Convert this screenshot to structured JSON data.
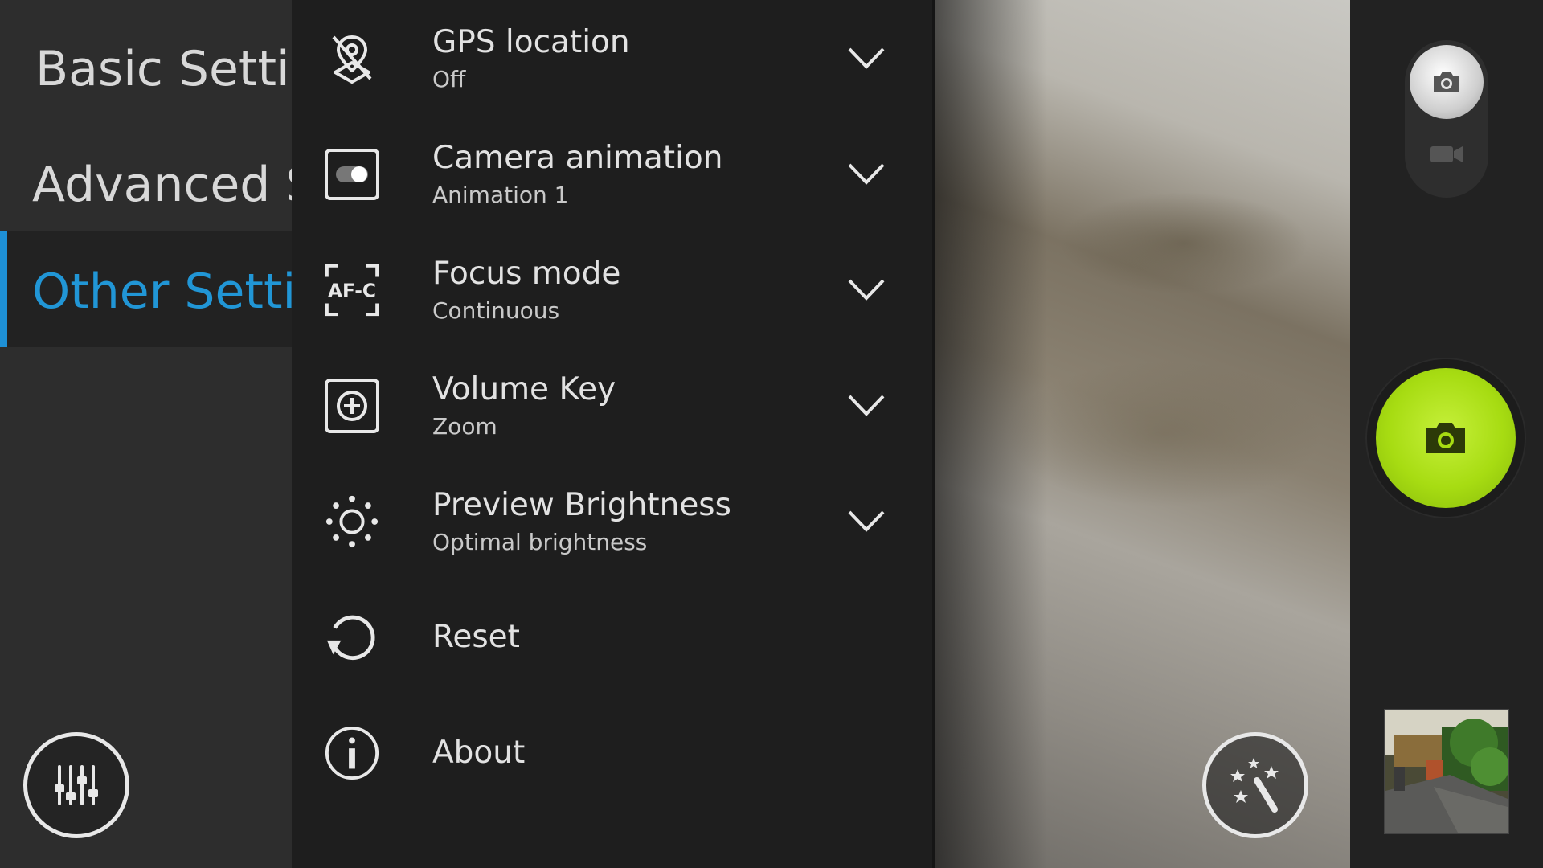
{
  "categories": [
    {
      "label": "Basic Settings",
      "active": false
    },
    {
      "label": "Advanced Settings",
      "active": false
    },
    {
      "label": "Other Settings",
      "active": true
    }
  ],
  "settings": [
    {
      "icon": "gps-off-icon",
      "title": "GPS location",
      "value": "Off",
      "has_dropdown": true
    },
    {
      "icon": "camera-animation-icon",
      "title": "Camera animation",
      "value": "Animation 1",
      "has_dropdown": true
    },
    {
      "icon": "focus-mode-afc-icon",
      "title": "Focus mode",
      "value": "Continuous",
      "has_dropdown": true,
      "icon_text": "AF-C"
    },
    {
      "icon": "volume-key-icon",
      "title": "Volume Key",
      "value": "Zoom",
      "has_dropdown": true
    },
    {
      "icon": "brightness-icon",
      "title": "Preview Brightness",
      "value": "Optimal brightness",
      "has_dropdown": true
    },
    {
      "icon": "reset-icon",
      "title": "Reset",
      "has_dropdown": false
    },
    {
      "icon": "info-icon",
      "title": "About",
      "has_dropdown": false
    }
  ],
  "colors": {
    "accent": "#1e90d6",
    "shutter": "#a7dc12",
    "text": "#e2e2e2"
  }
}
